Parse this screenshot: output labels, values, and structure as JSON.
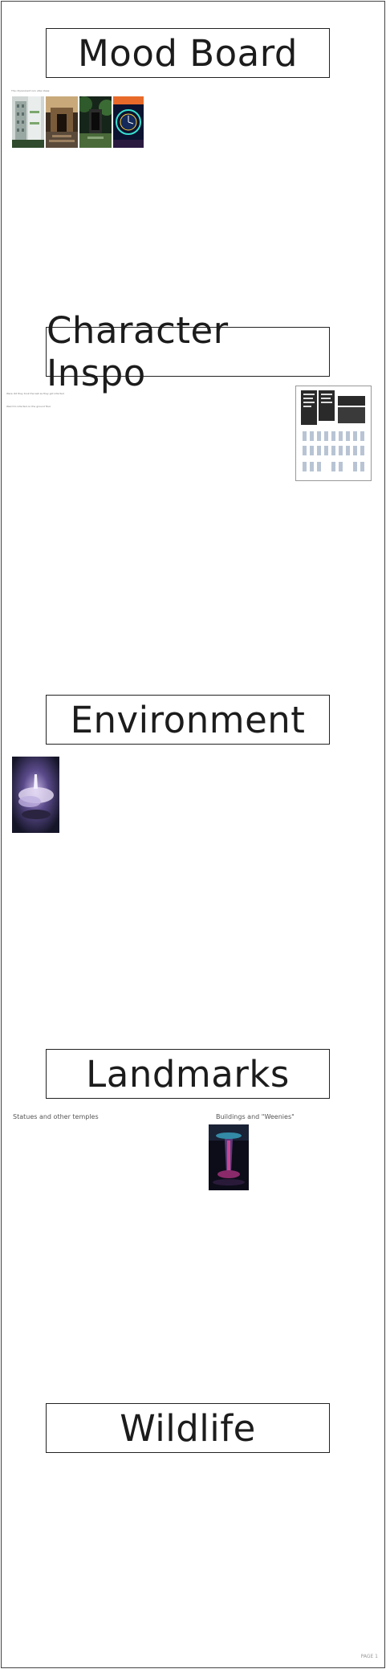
{
  "sections": {
    "mood_board": {
      "title": "Mood Board",
      "note": "The city/ancient ruin vibe ideas:"
    },
    "character_inspo": {
      "title": "Character Inspo",
      "note_1": "Were did they took the last as they got infected",
      "note_2": "Weird to infected on the ground floor"
    },
    "environment": {
      "title": "Environment"
    },
    "landmarks": {
      "title": "Landmarks",
      "label_left": "Statues and other temples",
      "label_right": "Buildings and \"Weenies\""
    },
    "wildlife": {
      "title": "Wildlife"
    }
  },
  "images": {
    "mood_1": "city-tower-photo",
    "mood_2": "ruined-temple-photo",
    "mood_3": "jungle-gate-photo",
    "mood_4": "neon-clock-photo",
    "character_sheet": "character-concept-sheet",
    "environment_1": "floating-island-painting",
    "landmark_1": "neon-tower-painting"
  },
  "footer": {
    "page_number": "PAGE 1"
  },
  "colors": {
    "border": "#222222",
    "background": "#ffffff",
    "label": "#555555"
  }
}
